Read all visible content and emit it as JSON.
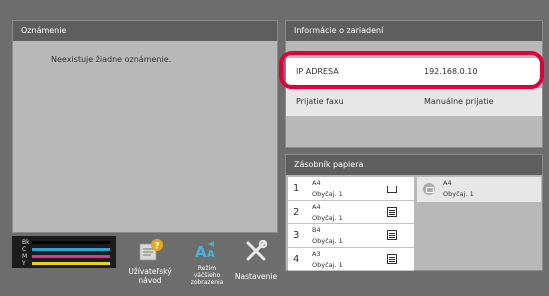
{
  "notice_panel": {
    "title": "Oznámenie",
    "message": "Neexistuje žiadne oznámenie."
  },
  "device_info": {
    "title": "Informácie o zariadení",
    "rows": [
      {
        "label": "IP ADRESA",
        "value": "192.168.0.10"
      },
      {
        "label": "Prijatie faxu",
        "value": "Manuálne prijatie"
      }
    ],
    "highlight_color": "#e3003a"
  },
  "paper_tray": {
    "title": "Zásobník papiera",
    "trays": [
      {
        "number": "1",
        "size": "A4",
        "type": "Obyčaj. 1",
        "icon": "tray-empty-icon"
      },
      {
        "number": "2",
        "size": "A4",
        "type": "Obyčaj. 1",
        "icon": "tray-cassette-icon"
      },
      {
        "number": "3",
        "size": "B4",
        "type": "Obyčaj. 1",
        "icon": "tray-cassette-icon"
      },
      {
        "number": "4",
        "size": "A3",
        "type": "Obyčaj. 1",
        "icon": "tray-cassette-icon"
      }
    ],
    "bypass": {
      "size": "A4",
      "type": "Obyčaj. 1",
      "icon": "bypass-tray-icon"
    }
  },
  "toner": {
    "levels": [
      {
        "label": "Bk",
        "color": "#000000"
      },
      {
        "label": "C",
        "color": "#29a8d8"
      },
      {
        "label": "M",
        "color": "#d8388c"
      },
      {
        "label": "Y",
        "color": "#e8d21a"
      }
    ]
  },
  "buttons": {
    "guide": {
      "line1": "Užívateľský",
      "line2": "návod",
      "icon": "guide-icon"
    },
    "zoom": {
      "line1": "Režim",
      "line2": "väčšieho",
      "line3": "zobrazenia",
      "icon": "zoom-mode-icon"
    },
    "settings": {
      "label": "Nastavenie",
      "icon": "settings-icon"
    }
  }
}
